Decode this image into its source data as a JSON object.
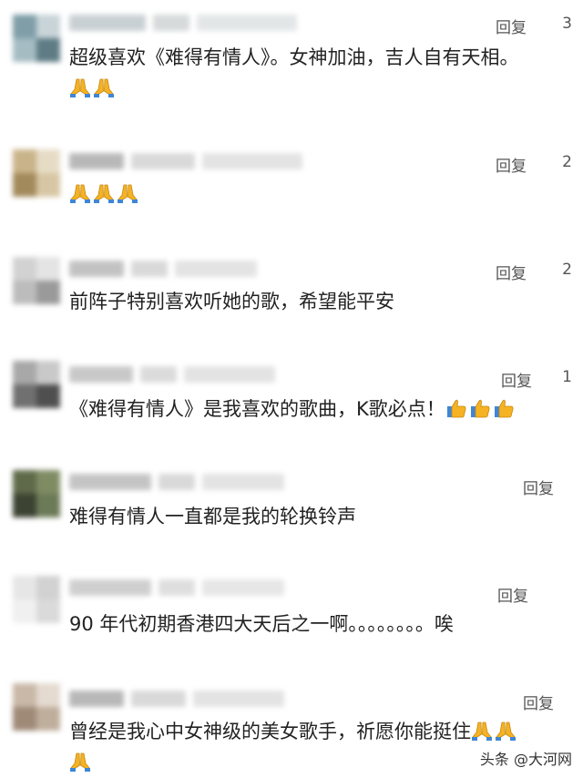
{
  "reply_label": "回复",
  "comments": [
    {
      "likes": "3",
      "text": "超级喜欢《难得有情人》。女神加油，吉人自有天相。",
      "emojis": [
        "pray",
        "pray"
      ]
    },
    {
      "likes": "2",
      "text": "",
      "emojis": [
        "pray",
        "pray",
        "pray"
      ]
    },
    {
      "likes": "2",
      "text": "前阵子特别喜欢听她的歌，希望能平安",
      "emojis": []
    },
    {
      "likes": "1",
      "text": "《难得有情人》是我喜欢的歌曲，K歌必点！",
      "emojis": [
        "thumbs-up",
        "thumbs-up",
        "thumbs-up"
      ]
    },
    {
      "likes": "",
      "text": "难得有情人一直都是我的轮换铃声",
      "emojis": []
    },
    {
      "likes": "",
      "text": "90 年代初期香港四大天后之一啊。。。。。。。。唉",
      "emojis": []
    },
    {
      "likes": "",
      "text": "曾经是我心中女神级的美女歌手，祈愿你能挺住",
      "emojis": [
        "pray",
        "pray",
        "pray"
      ]
    }
  ],
  "watermark": "头条 @大河网",
  "colors": {
    "text": "#222222",
    "meta": "#555555",
    "emoji": "#f5b323"
  }
}
